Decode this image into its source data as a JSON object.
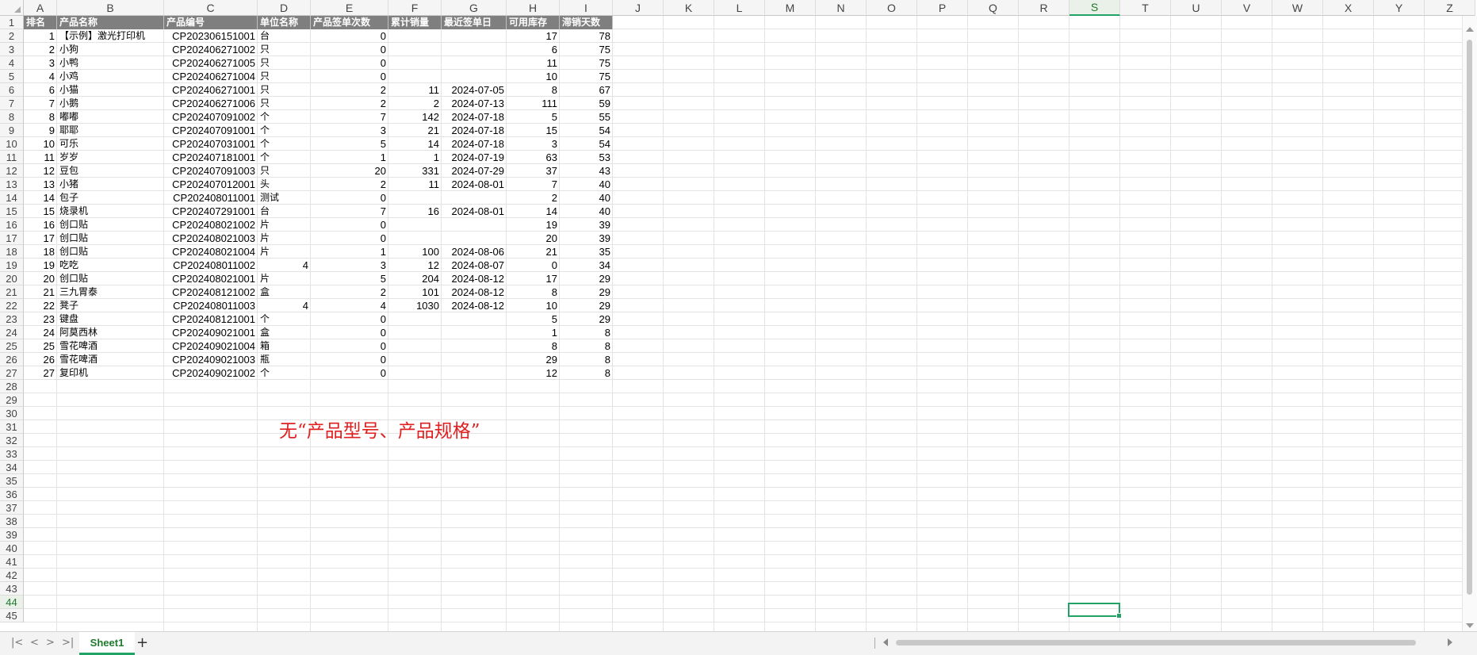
{
  "columns": [
    "A",
    "B",
    "C",
    "D",
    "E",
    "F",
    "G",
    "H",
    "I",
    "J",
    "K",
    "L",
    "M",
    "N",
    "O",
    "P",
    "Q",
    "R",
    "S",
    "T",
    "U",
    "V",
    "W",
    "X",
    "Y",
    "Z"
  ],
  "selected_column": "S",
  "selected_row": "44",
  "row_numbers": [
    "1",
    "2",
    "3",
    "4",
    "5",
    "6",
    "7",
    "8",
    "9",
    "10",
    "11",
    "12",
    "13",
    "14",
    "15",
    "16",
    "17",
    "18",
    "19",
    "20",
    "21",
    "22",
    "23",
    "24",
    "25",
    "26",
    "27",
    "28",
    "29",
    "30",
    "31",
    "32",
    "33",
    "34",
    "35",
    "36",
    "37",
    "38",
    "39",
    "40",
    "41",
    "42",
    "43",
    "44",
    "45"
  ],
  "headers": [
    "排名",
    "产品名称",
    "产品编号",
    "单位名称",
    "产品签单次数",
    "累计销量",
    "最近签单日",
    "可用库存",
    "滞销天数"
  ],
  "rows": [
    [
      "1",
      "【示例】激光打印机",
      "CP202306151001",
      "台",
      "",
      "0",
      "",
      "",
      "17",
      "78"
    ],
    [
      "2",
      "小狗",
      "CP202406271002",
      "只",
      "",
      "0",
      "",
      "",
      "6",
      "75"
    ],
    [
      "3",
      "小鸭",
      "CP202406271005",
      "只",
      "",
      "0",
      "",
      "",
      "11",
      "75"
    ],
    [
      "4",
      "小鸡",
      "CP202406271004",
      "只",
      "",
      "0",
      "",
      "",
      "10",
      "75"
    ],
    [
      "6",
      "小猫",
      "CP202406271001",
      "只",
      "",
      "2",
      "11",
      "2024-07-05",
      "8",
      "67"
    ],
    [
      "7",
      "小鹅",
      "CP202406271006",
      "只",
      "",
      "2",
      "2",
      "2024-07-13",
      "111",
      "59"
    ],
    [
      "8",
      "嘟嘟",
      "CP202407091002",
      "个",
      "",
      "7",
      "142",
      "2024-07-18",
      "5",
      "55"
    ],
    [
      "9",
      "耶耶",
      "CP202407091001",
      "个",
      "",
      "3",
      "21",
      "2024-07-18",
      "15",
      "54"
    ],
    [
      "10",
      "可乐",
      "CP202407031001",
      "个",
      "",
      "5",
      "14",
      "2024-07-18",
      "3",
      "54"
    ],
    [
      "11",
      "岁岁",
      "CP202407181001",
      "个",
      "",
      "1",
      "1",
      "2024-07-19",
      "63",
      "53"
    ],
    [
      "12",
      "豆包",
      "CP202407091003",
      "只",
      "",
      "20",
      "331",
      "2024-07-29",
      "37",
      "43"
    ],
    [
      "13",
      "小猪",
      "CP202407012001",
      "头",
      "",
      "2",
      "11",
      "2024-08-01",
      "7",
      "40"
    ],
    [
      "14",
      "包子",
      "CP202408011001",
      "测试",
      "",
      "0",
      "",
      "",
      "2",
      "40"
    ],
    [
      "15",
      "烧录机",
      "CP202407291001",
      "台",
      "",
      "7",
      "16",
      "2024-08-01",
      "14",
      "40"
    ],
    [
      "16",
      "创口贴",
      "CP202408021002",
      "片",
      "",
      "0",
      "",
      "",
      "19",
      "39"
    ],
    [
      "17",
      "创口贴",
      "CP202408021003",
      "片",
      "",
      "0",
      "",
      "",
      "20",
      "39"
    ],
    [
      "18",
      "创口贴",
      "CP202408021004",
      "片",
      "",
      "1",
      "100",
      "2024-08-06",
      "21",
      "35"
    ],
    [
      "19",
      "吃吃",
      "CP202408011002",
      "",
      "4",
      "3",
      "12",
      "2024-08-07",
      "0",
      "34"
    ],
    [
      "20",
      "创口贴",
      "CP202408021001",
      "片",
      "",
      "5",
      "204",
      "2024-08-12",
      "17",
      "29"
    ],
    [
      "21",
      "三九胃泰",
      "CP202408121002",
      "盒",
      "",
      "2",
      "101",
      "2024-08-12",
      "8",
      "29"
    ],
    [
      "22",
      "凳子",
      "CP202408011003",
      "",
      "4",
      "4",
      "1030",
      "2024-08-12",
      "10",
      "29"
    ],
    [
      "23",
      "键盘",
      "CP202408121001",
      "个",
      "",
      "0",
      "",
      "",
      "5",
      "29"
    ],
    [
      "24",
      "阿莫西林",
      "CP202409021001",
      "盒",
      "",
      "0",
      "",
      "",
      "1",
      "8"
    ],
    [
      "25",
      "雪花啤酒",
      "CP202409021004",
      "箱",
      "",
      "0",
      "",
      "",
      "8",
      "8"
    ],
    [
      "26",
      "雪花啤酒",
      "CP202409021003",
      "瓶",
      "",
      "0",
      "",
      "",
      "29",
      "8"
    ],
    [
      "27",
      "复印机",
      "CP202409021002",
      "个",
      "",
      "0",
      "",
      "",
      "12",
      "8"
    ]
  ],
  "note": "无“产品型号、产品规格”",
  "sheet_tab": "Sheet1",
  "add_sheet": "+",
  "nav": [
    "|<",
    "<",
    ">",
    ">|"
  ],
  "colors": {
    "accent": "#21a366",
    "header_fill": "#7f7f7f",
    "note": "#e02020"
  }
}
